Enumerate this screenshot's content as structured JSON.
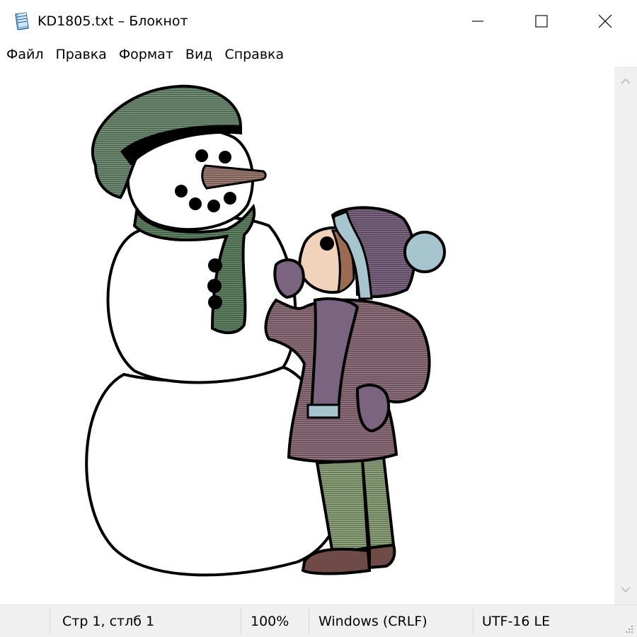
{
  "window": {
    "title": "KD1805.txt – Блокнот",
    "app_icon": "notepad-icon",
    "controls": [
      "minimize-icon",
      "maximize-icon",
      "close-icon"
    ]
  },
  "menu": {
    "items": [
      {
        "label": "Файл"
      },
      {
        "label": "Правка"
      },
      {
        "label": "Формат"
      },
      {
        "label": "Вид"
      },
      {
        "label": "Справка"
      }
    ]
  },
  "editor": {
    "content": "ASCII-art clipart of a child in a winter hat and coat looking up at a snowman wearing a green cap and scarf",
    "colors": {
      "outline": "#000000",
      "cap_green": "#6e8c72",
      "scarf_green": "#5f8262",
      "nose_brown": "#9b7a72",
      "coat_mauve": "#8d6e7a",
      "hat_purple": "#7a6480",
      "hat_lightblue": "#a7c5cf",
      "pants_green": "#8ca27a",
      "boots_brown": "#6e4b46",
      "skin": "#f1d3bb",
      "hair_brown": "#9a6b50"
    }
  },
  "scrollbar": {
    "up_icon": "chevron-up-icon",
    "down_icon": "chevron-down-icon"
  },
  "status": {
    "position": "Стр 1, стлб 1",
    "zoom": "100%",
    "line_endings": "Windows (CRLF)",
    "encoding": "UTF-16 LE"
  }
}
